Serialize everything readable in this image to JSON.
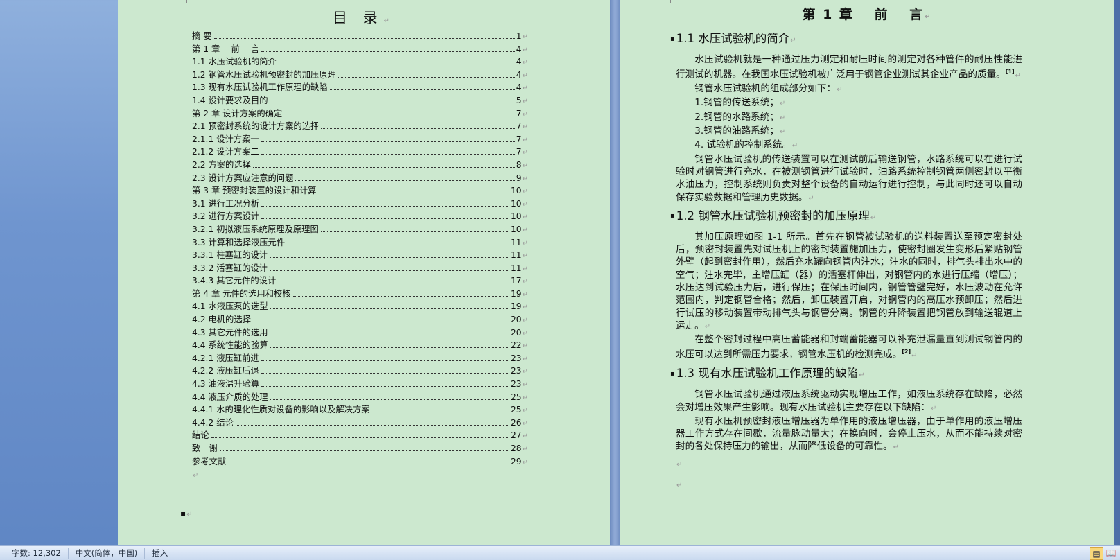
{
  "left_page": {
    "title": "目 录",
    "toc": [
      {
        "label": "摘 要",
        "page": "1"
      },
      {
        "label": "第 1 章　 前　 言",
        "page": "4"
      },
      {
        "label": "1.1  水压试验机的简介",
        "page": "4"
      },
      {
        "label": "1.2  钢管水压试验机预密封的加压原理",
        "page": "4"
      },
      {
        "label": "1.3  现有水压试验机工作原理的缺陷",
        "page": "4"
      },
      {
        "label": "1.4  设计要求及目的",
        "page": "5"
      },
      {
        "label": "第 2 章  设计方案的确定",
        "page": "7"
      },
      {
        "label": "2.1  预密封系统的设计方案的选择",
        "page": "7"
      },
      {
        "label": "2.1.1  设计方案一",
        "page": "7"
      },
      {
        "label": "2.1.2  设计方案二",
        "page": "7"
      },
      {
        "label": "2.2 方案的选择",
        "page": "8"
      },
      {
        "label": "2.3  设计方案应注意的问题",
        "page": "9"
      },
      {
        "label": "第 3 章  预密封装置的设计和计算",
        "page": "10"
      },
      {
        "label": "3.1  进行工况分析",
        "page": "10"
      },
      {
        "label": "3.2  进行方案设计",
        "page": "10"
      },
      {
        "label": "3.2.1  初拟液压系统原理及原理图",
        "page": "10"
      },
      {
        "label": "3.3  计算和选择液压元件",
        "page": "11"
      },
      {
        "label": "3.3.1 柱塞缸的设计",
        "page": "11"
      },
      {
        "label": "3.3.2 活塞缸的设计",
        "page": "11"
      },
      {
        "label": "3.4.3  其它元件的设计",
        "page": "17"
      },
      {
        "label": "第 4 章  元件的选用和校核",
        "page": "19"
      },
      {
        "label": "4.1 水液压泵的选型",
        "page": "19"
      },
      {
        "label": "4.2 电机的选择",
        "page": "20"
      },
      {
        "label": "4.3  其它元件的选用",
        "page": "20"
      },
      {
        "label": "4.4 系统性能的验算",
        "page": "22"
      },
      {
        "label": "4.2.1 液压缸前进",
        "page": "23"
      },
      {
        "label": "4.2.2 液压缸后退",
        "page": "23"
      },
      {
        "label": "4.3  油液温升验算",
        "page": "23"
      },
      {
        "label": "4.4 液压介质的处理",
        "page": "25"
      },
      {
        "label": "4.4.1 水的理化性质对设备的影响以及解决方案",
        "page": "25"
      },
      {
        "label": "4.4.2 结论",
        "page": "26"
      },
      {
        "label": "结论",
        "page": "27"
      },
      {
        "label": "致　谢",
        "page": "28"
      },
      {
        "label": "参考文献",
        "page": "29"
      }
    ]
  },
  "right_page": {
    "title": "第 1 章　 前　 言",
    "s1": {
      "heading": "1.1  水压试验机的简介",
      "p1": "水压试验机就是一种通过压力测定和耐压时间的测定对各种管件的耐压性能进行测试的机器。在我国水压试验机被广泛用于钢管企业测试其企业产品的质量。",
      "p1_ref": "[1]",
      "p2": "钢管水压试验机的组成部分如下：",
      "list": [
        "1.钢管的传送系统；",
        "2.钢管的水路系统；",
        "3.钢管的油路系统；",
        "4. 试验机的控制系统。"
      ],
      "p3": "钢管水压试验机的传送装置可以在测试前后输送钢管，水路系统可以在进行试验时对钢管进行充水，在被测钢管进行试验时，油路系统控制钢管两侧密封以平衡水油压力，控制系统则负责对整个设备的自动运行进行控制，与此同时还可以自动保存实验数据和管理历史数据。"
    },
    "s2": {
      "heading": "1.2  钢管水压试验机预密封的加压原理",
      "p1": "其加压原理如图 1-1 所示。首先在钢管被试验机的送料装置送至预定密封处后，预密封装置先对试压机上的密封装置施加压力，使密封圈发生变形后紧贴钢管外壁（起到密封作用），然后充水罐向钢管内注水；注水的同时，排气头排出水中的空气；注水完毕，主增压缸（器）的活塞杆伸出，对钢管内的水进行压缩（增压）；水压达到试验压力后，进行保压；在保压时间内，钢管管壁完好，水压波动在允许范围内，判定钢管合格；然后，卸压装置开启，对钢管内的高压水预卸压；然后进行试压的移动装置带动排气头与钢管分离。钢管的升降装置把钢管放到输送辊道上运走。",
      "p2": "在整个密封过程中高压蓄能器和封端蓄能器可以补充泄漏量直到测试钢管内的水压可以达到所需压力要求，钢管水压机的检测完成。",
      "p2_ref": "[2]"
    },
    "s3": {
      "heading": "1.3  现有水压试验机工作原理的缺陷",
      "p1": "钢管水压试验机通过液压系统驱动实现增压工作，如液压系统存在缺陷，必然会对增压效果产生影响。现有水压试验机主要存在以下缺陷：",
      "p2": "现有水压机预密封液压增压器为单作用的液压增压器，由于单作用的液压增压器工作方式存在间歇，流量脉动量大；在换向时，会停止压水，从而不能持续对密封的各处保持压力的输出，从而降低设备的可靠性。"
    }
  },
  "status_bar": {
    "word_count": "字数: 12,302",
    "language": "中文(简体，中国)",
    "mode": "插入"
  },
  "para_mark": "↵"
}
